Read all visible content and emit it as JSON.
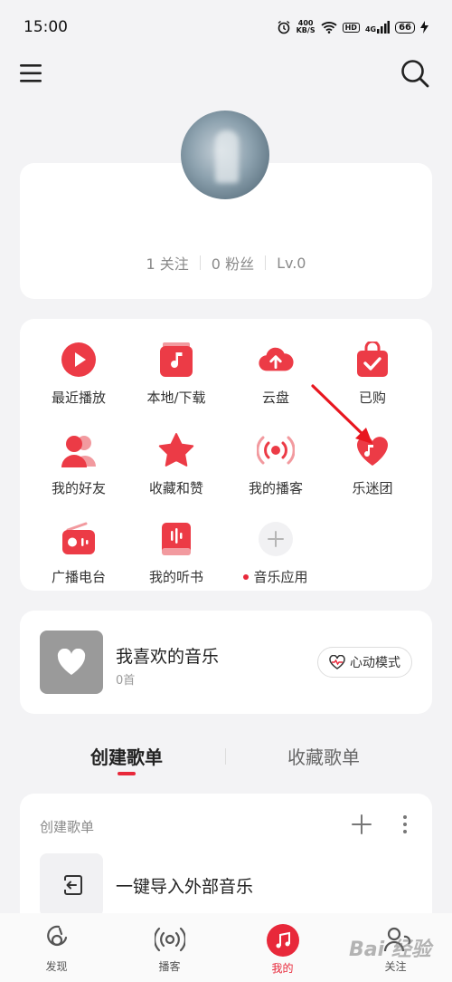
{
  "status_bar": {
    "time": "15:00",
    "net_speed_value": "400",
    "net_speed_unit": "KB/S",
    "hd": "HD",
    "signal": "4G",
    "battery": "66"
  },
  "top_nav": {
    "menu_icon": "menu-icon",
    "search_icon": "search-icon"
  },
  "profile": {
    "following": "1 关注",
    "followers": "0 粉丝",
    "level": "Lv.0"
  },
  "shortcuts": [
    {
      "label": "最近播放",
      "icon": "play-circle-icon"
    },
    {
      "label": "本地/下载",
      "icon": "local-music-icon"
    },
    {
      "label": "云盘",
      "icon": "cloud-upload-icon"
    },
    {
      "label": "已购",
      "icon": "purchased-bag-icon"
    },
    {
      "label": "我的好友",
      "icon": "friends-icon"
    },
    {
      "label": "收藏和赞",
      "icon": "star-icon"
    },
    {
      "label": "我的播客",
      "icon": "podcast-icon"
    },
    {
      "label": "乐迷团",
      "icon": "fan-club-heart-icon"
    },
    {
      "label": "广播电台",
      "icon": "radio-icon"
    },
    {
      "label": "我的听书",
      "icon": "audiobook-icon"
    },
    {
      "label": "音乐应用",
      "icon": "add-icon"
    }
  ],
  "liked_music": {
    "title": "我喜欢的音乐",
    "count": "0首",
    "heart_mode_label": "心动模式"
  },
  "tabs": {
    "created": "创建歌单",
    "collected": "收藏歌单"
  },
  "playlists": {
    "header": "创建歌单",
    "import_label": "一键导入外部音乐"
  },
  "bottom_nav": [
    {
      "label": "发现",
      "icon": "discover-icon"
    },
    {
      "label": "播客",
      "icon": "podcast-icon"
    },
    {
      "label": "我的",
      "icon": "music-note-icon"
    },
    {
      "label": "关注",
      "icon": "follow-icon"
    }
  ],
  "watermark": "Bai 经验",
  "colors": {
    "accent": "#e8283a",
    "background": "#f3f3f5",
    "card": "#ffffff"
  }
}
